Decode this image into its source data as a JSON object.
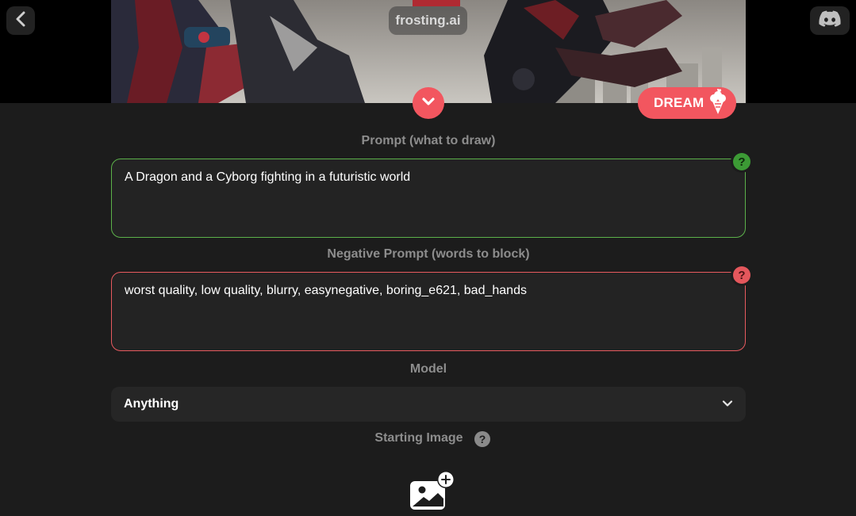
{
  "header": {
    "brand": "frosting.ai",
    "back_icon": "chevron-left-icon",
    "discord_icon": "discord-icon"
  },
  "actions": {
    "collapse_icon": "chevron-down-icon",
    "dream_label": "DREAM",
    "dream_icon": "ice-cream-cone-icon"
  },
  "prompt": {
    "label": "Prompt (what to draw)",
    "value": "A Dragon and a Cyborg fighting in a futuristic world",
    "help": "?"
  },
  "negative_prompt": {
    "label": "Negative Prompt (words to block)",
    "value": "worst quality, low quality, blurry, easynegative, boring_e621, bad_hands",
    "help": "?"
  },
  "model": {
    "label": "Model",
    "selected": "Anything"
  },
  "starting_image": {
    "label": "Starting Image",
    "help": "?",
    "upload_icon": "add-image-icon"
  },
  "colors": {
    "accent": "#f2565f",
    "prompt_border": "#5cb14a",
    "negative_border": "#e85a5f",
    "background": "#1c1c1c"
  }
}
